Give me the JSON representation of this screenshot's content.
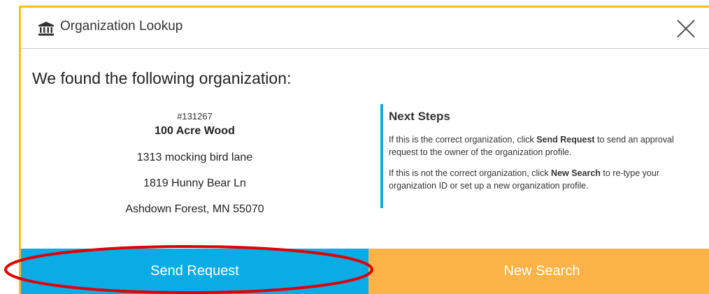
{
  "dialog": {
    "title": "Organization Lookup",
    "header_icon": "institution-icon",
    "close_icon": "close-icon"
  },
  "main": {
    "heading": "We found the following organization:"
  },
  "organization": {
    "id": "#131267",
    "name": "100 Acre Wood",
    "address_line1": "1313 mocking bird lane",
    "address_line2": "1819 Hunny Bear Ln",
    "city_state_zip": "Ashdown Forest, MN 55070"
  },
  "next_steps": {
    "title": "Next Steps",
    "p1_before": "If this is the correct organization, click ",
    "p1_bold": "Send Request",
    "p1_after": " to send an approval request to the owner of the organization profile.",
    "p2_before": "If this is not the correct organization, click ",
    "p2_bold": "New Search",
    "p2_after": " to re-type your organization ID or set up a new organization profile."
  },
  "buttons": {
    "send_request": "Send Request",
    "new_search": "New Search"
  },
  "colors": {
    "border_accent": "#f7c11a",
    "send_request_bg": "#0aace6",
    "new_search_bg": "#fdb347",
    "next_steps_rule": "#1ba4e3",
    "annotation_ellipse": "#e00000"
  }
}
